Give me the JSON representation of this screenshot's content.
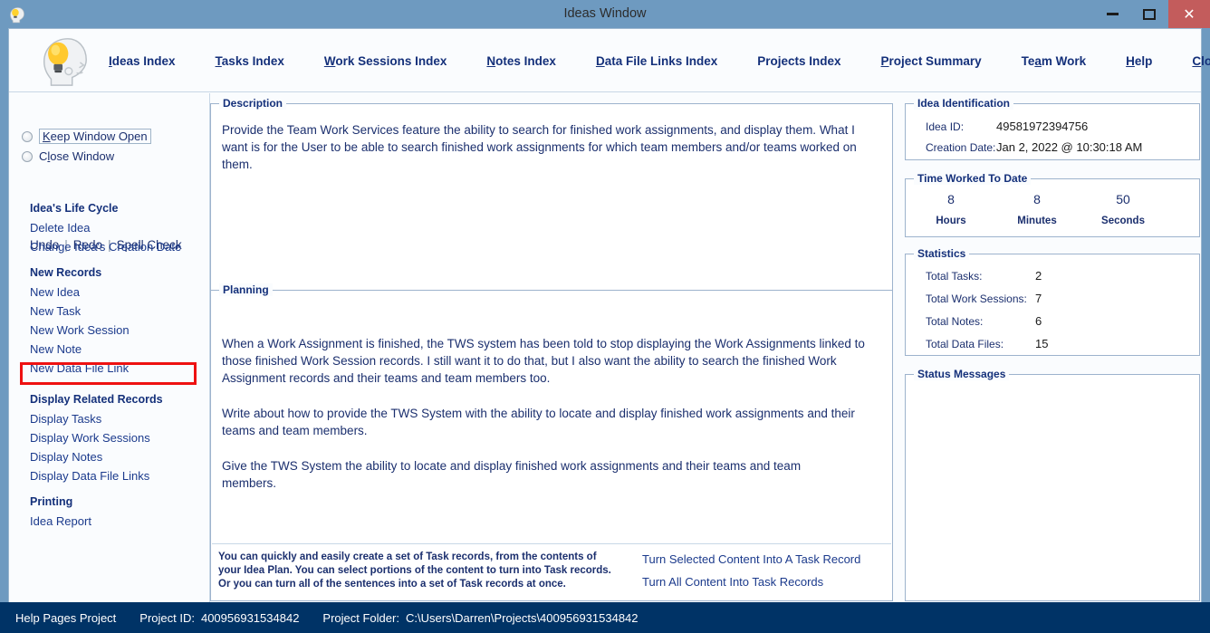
{
  "window": {
    "title": "Ideas Window",
    "icon": "lightbulb-head-icon",
    "minimize": "—",
    "maximize": "□",
    "close": "✕",
    "titlebar_color": "#6E9AC0",
    "close_button_color": "#C35C5C"
  },
  "menu": {
    "brand_icon": "lightbulb-head-icon",
    "items": [
      {
        "label": "Ideas Index",
        "accel": "I"
      },
      {
        "label": "Tasks Index",
        "accel": "T"
      },
      {
        "label": "Work Sessions Index",
        "accel": "W"
      },
      {
        "label": "Notes Index",
        "accel": "N"
      },
      {
        "label": "Data File Links Index",
        "accel": "D"
      },
      {
        "label": "Projects Index",
        "accel": ""
      },
      {
        "label": "Project Summary",
        "accel": "P"
      },
      {
        "label": "Team Work",
        "accel": "a"
      },
      {
        "label": "Help",
        "accel": "H"
      },
      {
        "label": "Close Program",
        "accel": "C"
      }
    ]
  },
  "sidebar": {
    "radios": [
      {
        "label": "Keep Window Open",
        "selected": false,
        "focused": true
      },
      {
        "label": "Close Window",
        "selected": false,
        "focused": false
      }
    ],
    "edit_actions": {
      "undo": "Undo",
      "redo": "Redo",
      "spell_check": "Spell Check",
      "separator": "|"
    },
    "groups": [
      {
        "heading": "Idea's Life Cycle",
        "links": [
          "Delete Idea",
          "Change Idea's Creation Date"
        ]
      },
      {
        "heading": "New Records",
        "links": [
          "New Idea",
          "New Task",
          "New Work Session",
          "New Note",
          "New Data File Link"
        ]
      },
      {
        "heading": "Display Related Records",
        "links": [
          "Display Tasks",
          "Display Work Sessions",
          "Display Notes",
          "Display Data File Links"
        ]
      },
      {
        "heading": "Printing",
        "links": [
          "Idea Report"
        ]
      }
    ],
    "highlight": {
      "target": "New Task",
      "color": "#ee1111"
    }
  },
  "description": {
    "title": "Description",
    "text": "Provide the Team Work Services feature the ability to search for finished work assignments, and display them. What I want is for the User to be able to search finished work assignments for which team members and/or teams worked on them."
  },
  "planning": {
    "title": "Planning",
    "paragraphs": [
      "When a Work Assignment is finished, the TWS system has been told to stop displaying the Work Assignments linked to those finished Work Session records. I still want it to do that, but I also want the ability to search the finished Work Assignment records and their teams and team members too.",
      "Write about how to provide the TWS System with the ability to locate and display finished work assignments and their teams and team members.",
      "Give the TWS System the ability to locate and display finished work assignments and their teams and team members."
    ],
    "hint": "You can quickly and easily create a set of Task records, from the contents of your Idea Plan. You can select portions of the content to turn into Task records. Or you can turn all of the sentences into a set of Task records at once.",
    "actions": [
      "Turn Selected Content Into A Task Record",
      "Turn All Content Into Task Records"
    ]
  },
  "idea_identification": {
    "title": "Idea Identification",
    "rows": [
      {
        "label": "Idea ID:",
        "value": "49581972394756"
      },
      {
        "label": "Creation Date:",
        "value": "Jan  2, 2022 @ 10:30:18 AM"
      }
    ]
  },
  "time_worked": {
    "title": "Time Worked To Date",
    "cells": [
      {
        "value": "8",
        "unit": "Hours"
      },
      {
        "value": "8",
        "unit": "Minutes"
      },
      {
        "value": "50",
        "unit": "Seconds"
      }
    ]
  },
  "statistics": {
    "title": "Statistics",
    "rows": [
      {
        "label": "Total Tasks:",
        "value": "2"
      },
      {
        "label": "Total Work Sessions:",
        "value": "7"
      },
      {
        "label": "Total Notes:",
        "value": "6"
      },
      {
        "label": "Total Data Files:",
        "value": "15"
      }
    ]
  },
  "status_messages": {
    "title": "Status Messages",
    "text": ""
  },
  "statusbar": {
    "project_name": "Help Pages Project",
    "project_id_label": "Project ID:",
    "project_id_value": "400956931534842",
    "project_folder_label": "Project Folder:",
    "project_folder_value": "C:\\Users\\Darren\\Projects\\400956931534842",
    "background_color": "#003366"
  }
}
